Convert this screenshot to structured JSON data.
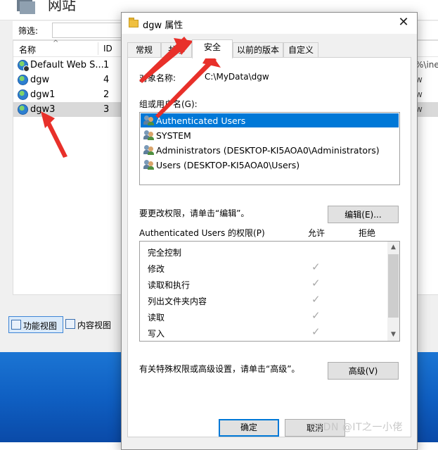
{
  "iis": {
    "title": "网站",
    "filter_label": "筛选:",
    "columns": {
      "name": "名称",
      "id": "ID"
    },
    "sites": [
      {
        "name": "Default Web S...",
        "id": "1",
        "tail": "%\\inet"
      },
      {
        "name": "dgw",
        "id": "4",
        "tail": "w"
      },
      {
        "name": "dgw1",
        "id": "2",
        "tail": "w"
      },
      {
        "name": "dgw3",
        "id": "3",
        "tail": "w"
      }
    ],
    "views": {
      "features": "功能视图",
      "content": "内容视图"
    }
  },
  "dialog": {
    "title": "dgw 属性",
    "close_glyph": "✕",
    "tabs": [
      "常规",
      "共享",
      "安全",
      "以前的版本",
      "自定义"
    ],
    "object_name_label": "对象名称:",
    "object_name_value": "C:\\MyData\\dgw",
    "group_label": "组或用户名(G):",
    "users": [
      "Authenticated Users",
      "SYSTEM",
      "Administrators (DESKTOP-KI5AOA0\\Administrators)",
      "Users (DESKTOP-KI5AOA0\\Users)"
    ],
    "change_perm_text": "要更改权限，请单击“编辑”。",
    "edit_button": "编辑(E)...",
    "perms_for_label": "Authenticated Users 的权限(P)",
    "allow_header": "允许",
    "deny_header": "拒绝",
    "permissions": [
      {
        "name": "完全控制",
        "allow": ""
      },
      {
        "name": "修改",
        "allow": "✓"
      },
      {
        "name": "读取和执行",
        "allow": "✓"
      },
      {
        "name": "列出文件夹内容",
        "allow": "✓"
      },
      {
        "name": "读取",
        "allow": "✓"
      },
      {
        "name": "写入",
        "allow": "✓"
      }
    ],
    "special_text": "有关特殊权限或高级设置，请单击“高级”。",
    "advanced_button": "高级(V)",
    "ok_button": "确定",
    "cancel_button": "取消"
  },
  "watermark": "CSDN @IT之一小佬",
  "colors": {
    "selection": "#0078d7",
    "annotation_arrow": "#e8302a"
  }
}
